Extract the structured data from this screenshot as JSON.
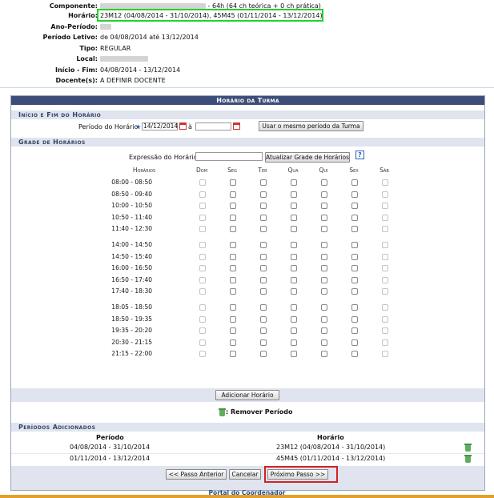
{
  "info": {
    "rows": [
      {
        "label": "Componente:",
        "value": "- 64h (64 ch teórica + 0 ch prática)",
        "redacted": true
      },
      {
        "label": "Horário:",
        "value": "23M12 (04/08/2014 - 31/10/2014), 45M45 (01/11/2014 - 13/12/2014)",
        "redacted": false
      },
      {
        "label": "Ano-Período:",
        "value": "",
        "redacted": true
      },
      {
        "label": "Período Letivo:",
        "value": "de 04/08/2014 até 13/12/2014",
        "redacted": false
      },
      {
        "label": "Tipo:",
        "value": "REGULAR",
        "redacted": false
      },
      {
        "label": "Local:",
        "value": "",
        "redacted": true
      },
      {
        "label": "Início - Fim:",
        "value": "04/08/2014 - 13/12/2014",
        "redacted": false
      },
      {
        "label": "Docente(s):",
        "value": "A DEFINIR DOCENTE",
        "redacted": false
      }
    ]
  },
  "panel": {
    "caption": "Horário da Turma",
    "section_periodo": "Início e Fim do Horário",
    "periodo_label": "Período do Horário:",
    "required_mark": "★",
    "start_date": "14/12/2014",
    "sep": "à",
    "end_date": "",
    "same_period_button": "Usar o mesmo período da Turma",
    "section_grade": "Grade de Horários",
    "expressao_label": "Expressão do Horário:",
    "expressao_value": "",
    "atualizar_button": "Atualizar Grade de Horários",
    "help_glyph": "?",
    "grid_head": "Horários",
    "days": [
      "Dom",
      "Seg",
      "Ter",
      "Qua",
      "Qui",
      "Sex",
      "Sáb"
    ],
    "time_blocks": [
      [
        "08:00 - 08:50",
        "08:50 - 09:40",
        "10:00 - 10:50",
        "10:50 - 11:40",
        "11:40 - 12:30"
      ],
      [
        "14:00 - 14:50",
        "14:50 - 15:40",
        "16:00 - 16:50",
        "16:50 - 17:40",
        "17:40 - 18:30"
      ],
      [
        "18:05 - 18:50",
        "18:50 - 19:35",
        "19:35 - 20:20",
        "20:30 - 21:15",
        "21:15 - 22:00"
      ]
    ],
    "add_button": "Adicionar Horário",
    "remove_legend": ": Remover Período",
    "section_added": "Períodos Adicionados",
    "added_headers": [
      "Período",
      "Horário"
    ],
    "added_rows": [
      {
        "periodo": "04/08/2014 - 31/10/2014",
        "horario": "23M12 (04/08/2014 - 31/10/2014)"
      },
      {
        "periodo": "01/11/2014 - 13/12/2014",
        "horario": "45M45 (01/11/2014 - 13/12/2014)"
      }
    ],
    "prev_button": "<< Passo Anterior",
    "cancel_button": "Cancelar",
    "next_button": "Próximo Passo >>"
  },
  "portal_link": "Portal do Coordenador",
  "colors": {
    "caption_bg": "#3c4d7a",
    "section_bg": "#dfe4ee",
    "highlight_green": "#22d12f",
    "highlight_red": "#d62020",
    "bottom_bar": "#e2a02a"
  }
}
